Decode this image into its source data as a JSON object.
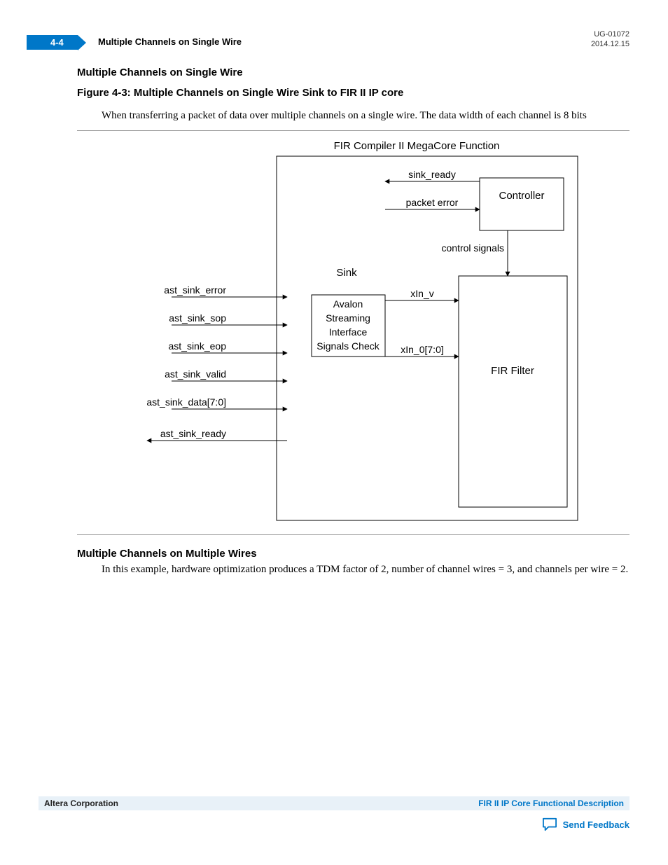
{
  "header": {
    "page_number": "4-4",
    "running_title": "Multiple Channels on Single Wire",
    "doc_id": "UG-01072",
    "doc_date": "2014.12.15"
  },
  "section1": {
    "title": "Multiple Channels on Single Wire",
    "figure_caption": "Figure 4-3: Multiple Channels on Single Wire Sink to FIR II IP core",
    "figure_desc": "When transferring a packet of data over multiple channels on a single wire. The data width of each channel is 8 bits"
  },
  "diagram": {
    "title": "FIR Compiler II MegaCore Function",
    "sink_block": "Sink",
    "avalon_block_l1": "Avalon",
    "avalon_block_l2": "Streaming",
    "avalon_block_l3": "Interface",
    "avalon_block_l4": "Signals Check",
    "controller_block": "Controller",
    "fir_block": "FIR Filter",
    "sig_sink_ready": "sink_ready",
    "sig_packet_error": "packet error",
    "sig_control": "control signals",
    "sig_xin_v": "xIn_v",
    "sig_xin_0": "xIn_0[7:0]",
    "ext_ast_sink_error": "ast_sink_error",
    "ext_ast_sink_sop": "ast_sink_sop",
    "ext_ast_sink_eop": "ast_sink_eop",
    "ext_ast_sink_valid": "ast_sink_valid",
    "ext_ast_sink_data": "ast_sink_data[7:0]",
    "ext_ast_sink_ready": "ast_sink_ready"
  },
  "section2": {
    "title": "Multiple Channels on Multiple Wires",
    "body": "In this example, hardware optimization produces a TDM factor of 2, number of channel wires = 3, and channels per wire = 2."
  },
  "footer": {
    "left": "Altera Corporation",
    "right": "FIR II IP Core Functional Description",
    "feedback": "Send Feedback"
  }
}
